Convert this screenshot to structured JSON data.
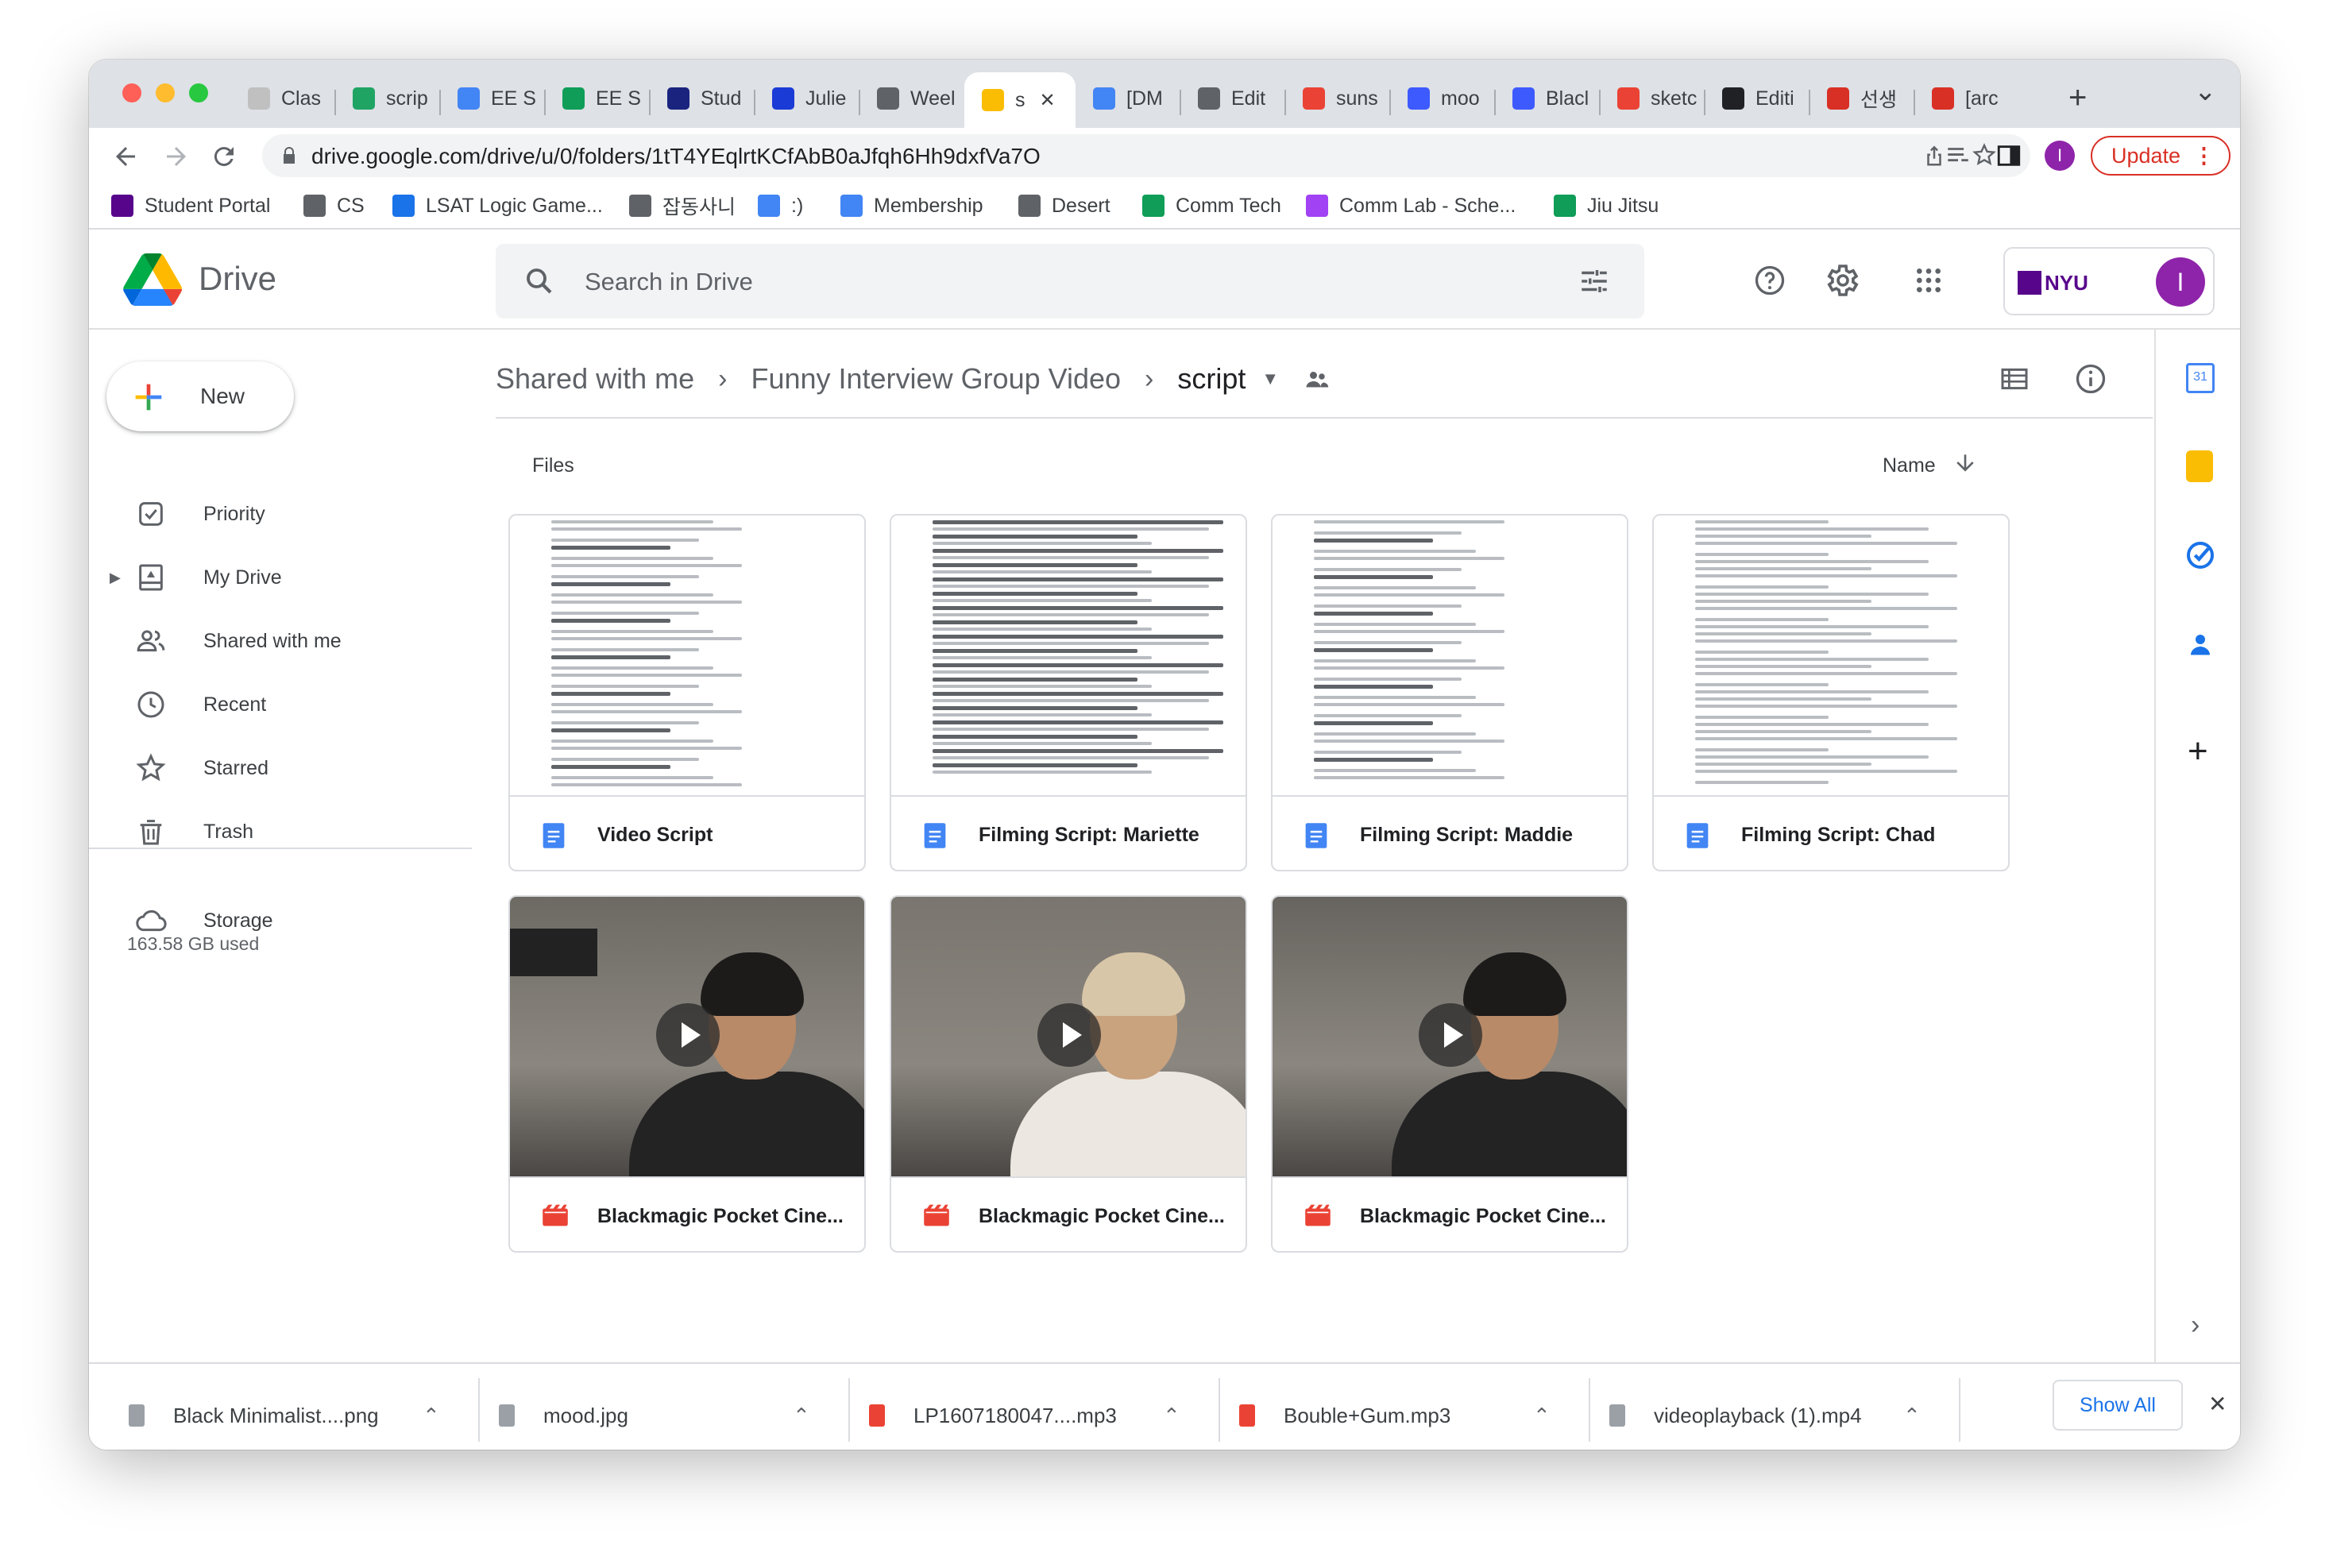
{
  "browser": {
    "tabs": [
      {
        "label": "Clas",
        "fav": "#c0c0c0"
      },
      {
        "label": "scrip",
        "fav": "#1fa463"
      },
      {
        "label": "EE S",
        "fav": "#4285f4"
      },
      {
        "label": "EE S",
        "fav": "#0f9d58"
      },
      {
        "label": "Stud",
        "fav": "#1a237e"
      },
      {
        "label": "Julie",
        "fav": "#1a3bd6"
      },
      {
        "label": "Weel",
        "fav": "#5f6368"
      },
      {
        "label": "s",
        "fav": "#fbbc04",
        "active": true
      },
      {
        "label": "[DM",
        "fav": "#4285f4"
      },
      {
        "label": "Edit",
        "fav": "#5f6368"
      },
      {
        "label": "suns",
        "fav": "#ea4335"
      },
      {
        "label": "moo",
        "fav": "#3d5afe"
      },
      {
        "label": "Blacl",
        "fav": "#3d5afe"
      },
      {
        "label": "sketc",
        "fav": "#ea4335"
      },
      {
        "label": "Editi",
        "fav": "#202124"
      },
      {
        "label": "선생",
        "fav": "#d93025"
      },
      {
        "label": "[arc",
        "fav": "#d93025"
      }
    ],
    "active_tab_close": "✕",
    "new_tab": "+",
    "tab_menu": "⌄",
    "url": "drive.google.com/drive/u/0/folders/1tT4YEqlrtKCfAbB0aJfqh6Hh9dxfVa7O",
    "profile_initial": "I",
    "update_label": "Update",
    "bookmarks": [
      {
        "label": "Student Portal",
        "color": "#57068c"
      },
      {
        "label": "CS",
        "color": "#5f6368"
      },
      {
        "label": "LSAT Logic Game...",
        "color": "#1a73e8"
      },
      {
        "label": "잡동사니",
        "color": "#5f6368"
      },
      {
        "label": ":)",
        "color": "#4285f4"
      },
      {
        "label": "Membership",
        "color": "#4285f4"
      },
      {
        "label": "Desert",
        "color": "#5f6368"
      },
      {
        "label": "Comm Tech",
        "color": "#0f9d58"
      },
      {
        "label": "Comm Lab - Sche...",
        "color": "#a142f4"
      },
      {
        "label": "Jiu Jitsu",
        "color": "#0f9d58"
      }
    ]
  },
  "drive": {
    "product_name": "Drive",
    "search_placeholder": "Search in Drive",
    "org_label": "NYU",
    "account_initial": "I",
    "new_label": "New",
    "nav": [
      {
        "label": "Priority",
        "icon": "priority-icon"
      },
      {
        "label": "My Drive",
        "icon": "my-drive-icon"
      },
      {
        "label": "Shared with me",
        "icon": "shared-icon"
      },
      {
        "label": "Recent",
        "icon": "clock-icon"
      },
      {
        "label": "Starred",
        "icon": "star-icon"
      },
      {
        "label": "Trash",
        "icon": "trash-icon"
      }
    ],
    "storage_label": "Storage",
    "storage_used": "163.58 GB used",
    "breadcrumb": [
      "Shared with me",
      "Funny Interview Group Video",
      "script"
    ],
    "section_label": "Files",
    "sort_label": "Name",
    "files": [
      {
        "name": "Video Script",
        "type": "doc"
      },
      {
        "name": "Filming Script: Mariette",
        "type": "doc"
      },
      {
        "name": "Filming Script: Maddie",
        "type": "doc"
      },
      {
        "name": "Filming Script: Chad",
        "type": "doc"
      },
      {
        "name": "Blackmagic Pocket Cine...",
        "type": "video"
      },
      {
        "name": "Blackmagic Pocket Cine...",
        "type": "video"
      },
      {
        "name": "Blackmagic Pocket Cine...",
        "type": "video"
      }
    ]
  },
  "downloads": {
    "items": [
      "Black Minimalist....png",
      "mood.jpg",
      "LP1607180047....mp3",
      "Bouble+Gum.mp3",
      "videoplayback (1).mp4"
    ],
    "show_all": "Show All",
    "close": "✕"
  }
}
